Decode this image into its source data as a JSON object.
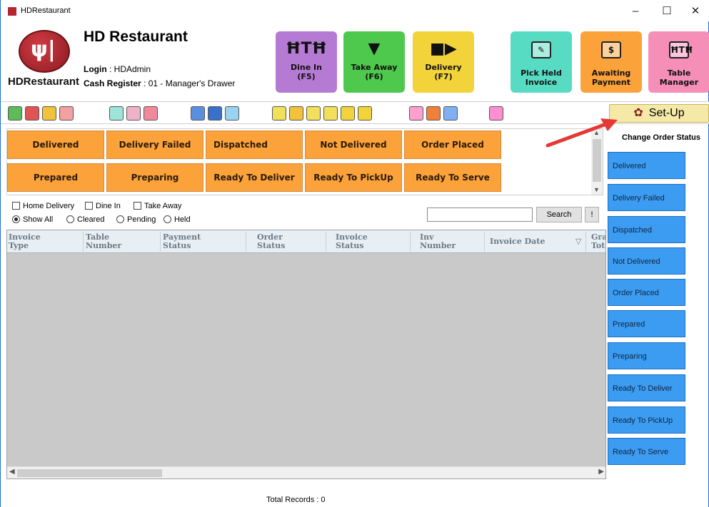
{
  "window": {
    "title": "HDRestaurant",
    "minimize": "–",
    "maximize": "☐",
    "close": "✕"
  },
  "header": {
    "logo_text": "HDRestaurant",
    "brand": "HD Restaurant",
    "login_label": "Login",
    "login_value": ": HDAdmin",
    "cash_label": "Cash Register",
    "cash_value": ": 01 - Manager's Drawer"
  },
  "actions": [
    {
      "label": "Dine In",
      "key": "(F5)",
      "icon": "table-icon",
      "glyph": "ℎΤℎ",
      "color": "#b57ad4"
    },
    {
      "label": "Take Away",
      "key": "(F6)",
      "icon": "cup-icon",
      "glyph": "🥤",
      "color": "#4fc94d"
    },
    {
      "label": "Delivery",
      "key": "(F7)",
      "icon": "truck-icon",
      "glyph": "🚚",
      "color": "#f2d43a"
    },
    {
      "label": "Pick Held",
      "key": "Invoice",
      "icon": "edit-icon",
      "glyph": "✎",
      "color": "#58dbc3"
    },
    {
      "label": "Awaiting",
      "key": "Payment",
      "icon": "money-icon",
      "glyph": "$",
      "color": "#fba23a"
    },
    {
      "label": "Table",
      "key": "Manager",
      "icon": "table-manager-icon",
      "glyph": "ℎΤℎ",
      "color": "#f58fb8"
    }
  ],
  "setup": {
    "label": "Set-Up"
  },
  "status_buttons": [
    "Delivered",
    "Delivery Failed",
    "Dispatched",
    "Not Delivered",
    "Order Placed",
    "Prepared",
    "Preparing",
    "Ready To Deliver",
    "Ready To PickUp",
    "Ready To Serve"
  ],
  "filters": {
    "checkboxes": [
      "Home Delivery",
      "Dine In",
      "Take Away"
    ],
    "radios": [
      "Show All",
      "Cleared",
      "Pending",
      "Held"
    ],
    "selected_radio": "Show All",
    "search_button": "Search",
    "bang_button": "!"
  },
  "table": {
    "columns": [
      [
        "Invoice",
        "Type"
      ],
      [
        "Table",
        "Number"
      ],
      [
        "Payment",
        "Status"
      ],
      [
        "Order",
        "Status"
      ],
      [
        "Invoice",
        "Status"
      ],
      [
        "Inv",
        "Number"
      ],
      [
        "Invoice Date",
        ""
      ],
      [
        "Gra",
        "Tot"
      ]
    ],
    "sort_glyph": "▽",
    "total_records": "Total Records : 0"
  },
  "right_panel": {
    "title": "Change Order Status",
    "buttons": [
      "Delivered",
      "Delivery Failed",
      "Dispatched",
      "Not Delivered",
      "Order Placed",
      "Prepared",
      "Preparing",
      "Ready To Deliver",
      "Ready To PickUp",
      "Ready To Serve"
    ]
  },
  "colors": {
    "status_orange": "#fba23a",
    "status_blue": "#3c9cf2",
    "logo_red": "#b3262b"
  }
}
